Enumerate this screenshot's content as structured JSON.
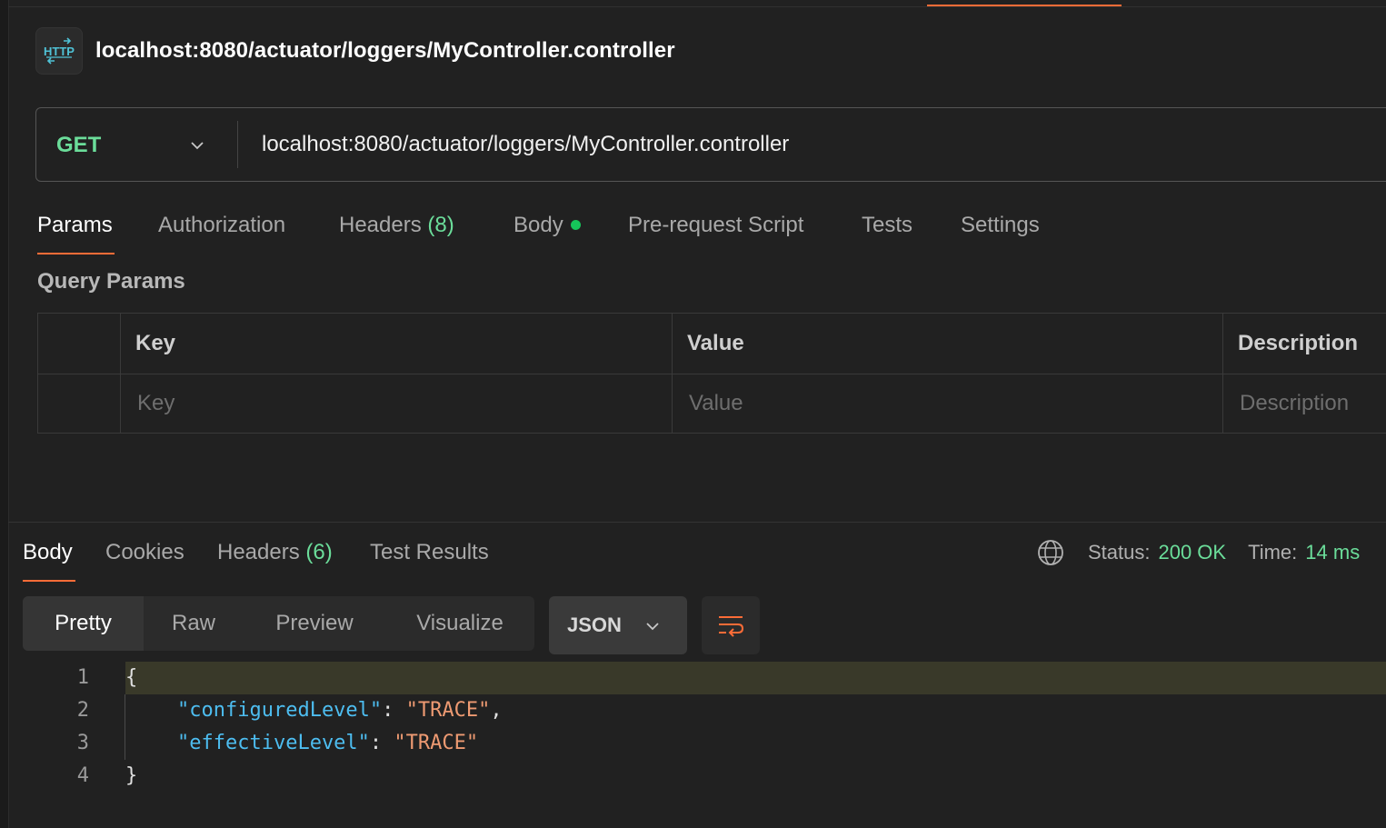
{
  "request": {
    "title": "localhost:8080/actuator/loggers/MyController.controller",
    "method": "GET",
    "url": "localhost:8080/actuator/loggers/MyController.controller"
  },
  "request_tabs": {
    "params": "Params",
    "authorization": "Authorization",
    "headers": "Headers",
    "headers_count": "(8)",
    "body": "Body",
    "prerequest": "Pre-request Script",
    "tests": "Tests",
    "settings": "Settings"
  },
  "query_params": {
    "title": "Query Params",
    "columns": [
      "Key",
      "Value",
      "Description"
    ],
    "placeholders": [
      "Key",
      "Value",
      "Description"
    ]
  },
  "response_tabs": {
    "body": "Body",
    "cookies": "Cookies",
    "headers": "Headers",
    "headers_count": "(6)",
    "test_results": "Test Results"
  },
  "response_status": {
    "status_label": "Status:",
    "status_value": "200 OK",
    "time_label": "Time:",
    "time_value": "14 ms"
  },
  "view_modes": [
    "Pretty",
    "Raw",
    "Preview",
    "Visualize"
  ],
  "format": "JSON",
  "code": {
    "line_numbers": [
      "1",
      "2",
      "3",
      "4"
    ],
    "open_brace": "{",
    "close_brace": "}",
    "entries": [
      {
        "key": "\"configuredLevel\"",
        "sep": ": ",
        "value": "\"TRACE\"",
        "trail": ","
      },
      {
        "key": "\"effectiveLevel\"",
        "sep": ": ",
        "value": "\"TRACE\"",
        "trail": ""
      }
    ]
  },
  "colors": {
    "accent": "#ff6c37",
    "method_green": "#6bdd9a",
    "status_green": "#6bdd9a",
    "body_dot": "#16c45a",
    "json_key": "#4dbdf0",
    "json_string": "#ee9a72"
  },
  "icons": {
    "request_type": "http-icon",
    "method_dropdown": "chevron-down-icon",
    "network": "globe-icon",
    "format_dropdown": "chevron-down-icon",
    "wrap": "wrap-lines-icon"
  }
}
